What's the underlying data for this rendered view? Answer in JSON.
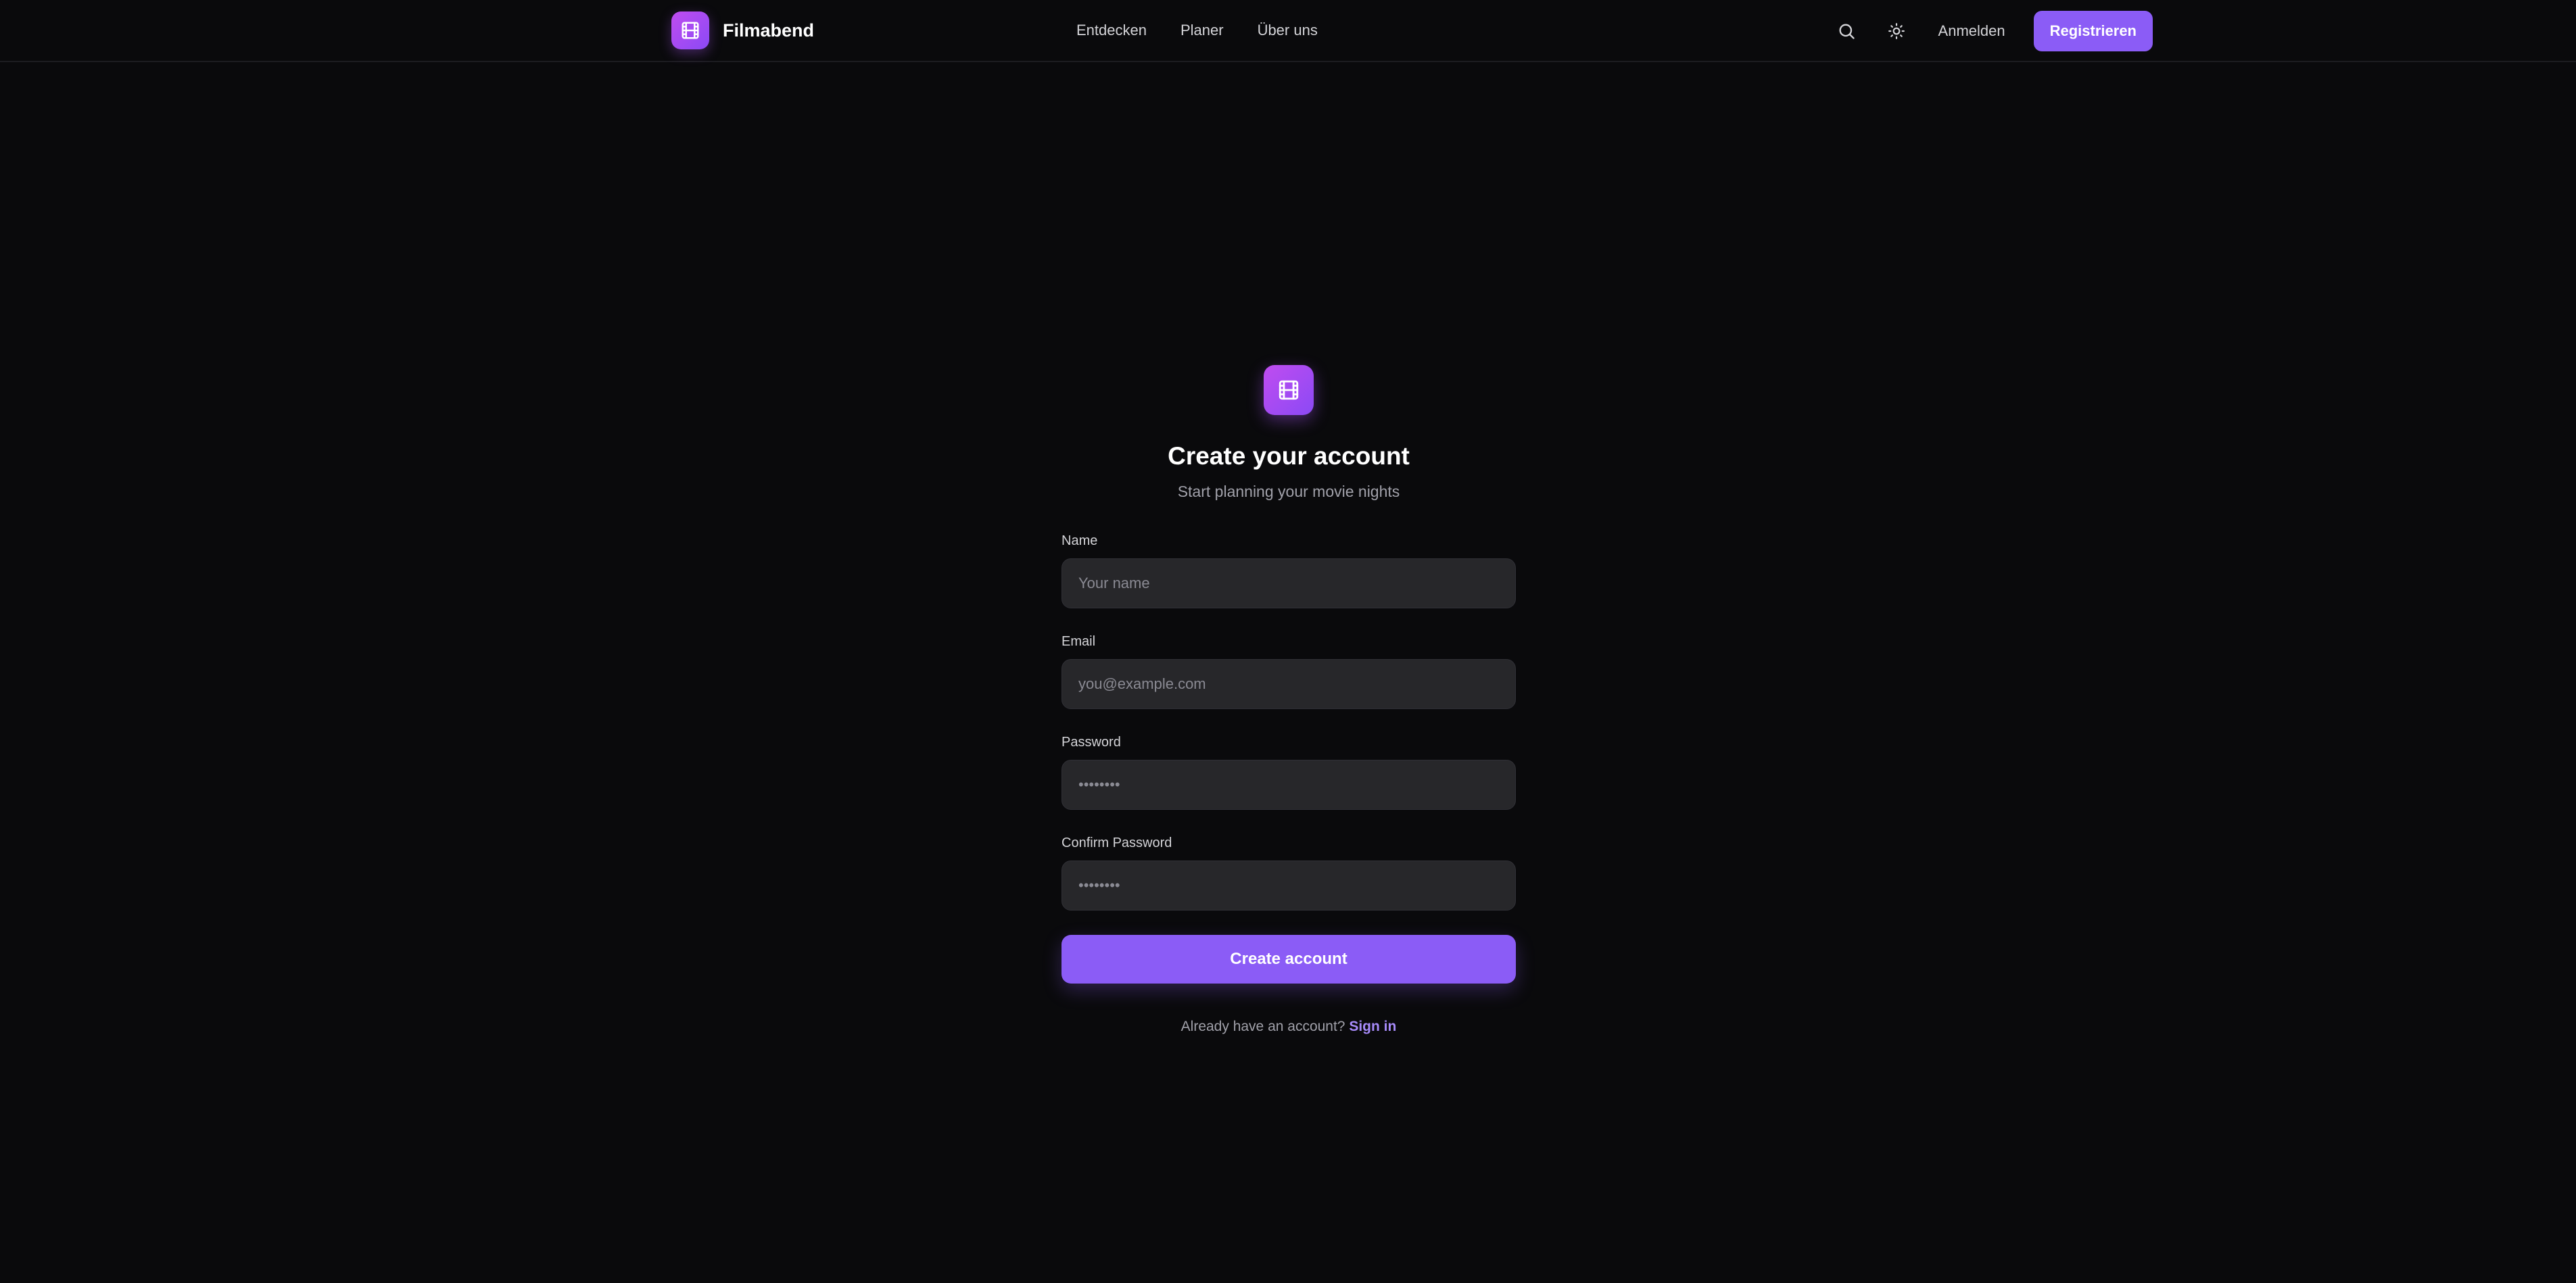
{
  "nav": {
    "brand": "Filmabend",
    "links": [
      "Entdecken",
      "Planer",
      "Über uns"
    ],
    "search_icon": "search-icon",
    "theme_icon": "sun-icon",
    "signin_label": "Anmelden",
    "register_label": "Registrieren"
  },
  "form": {
    "logo_icon": "film-icon",
    "title": "Create your account",
    "subtitle": "Start planning your movie nights",
    "name_label": "Name",
    "name_placeholder": "Your name",
    "email_label": "Email",
    "email_placeholder": "you@example.com",
    "password_label": "Password",
    "password_placeholder": "••••••••",
    "confirm_label": "Confirm Password",
    "confirm_placeholder": "••••••••",
    "submit_label": "Create account",
    "footer_text": "Already have an account?",
    "footer_link": "Sign in"
  },
  "colors": {
    "background": "#0a0a0c",
    "accent": "#8b5cf6",
    "input_bg": "#27272a",
    "link": "#a78bfa"
  }
}
